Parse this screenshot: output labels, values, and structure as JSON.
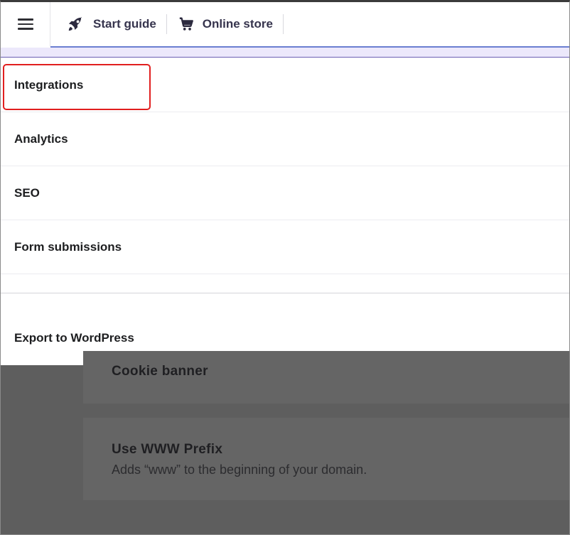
{
  "header": {
    "tabs": [
      {
        "label": "Start guide",
        "icon": "rocket-icon"
      },
      {
        "label": "Online store",
        "icon": "cart-icon"
      }
    ]
  },
  "menu": {
    "items": [
      {
        "label": "Integrations",
        "highlighted": true
      },
      {
        "label": "Analytics"
      },
      {
        "label": "SEO"
      },
      {
        "label": "Form submissions"
      },
      {
        "label": "Export to WordPress"
      }
    ]
  },
  "background": {
    "cards": [
      {
        "title": "Cookie banner"
      },
      {
        "title": "Use WWW Prefix",
        "description": "Adds “www” to the beginning of your domain."
      }
    ]
  },
  "colors": {
    "highlight_border": "#e11f1f",
    "overlay": "#5e5e5e",
    "accent_strip": "#ece8fb"
  }
}
